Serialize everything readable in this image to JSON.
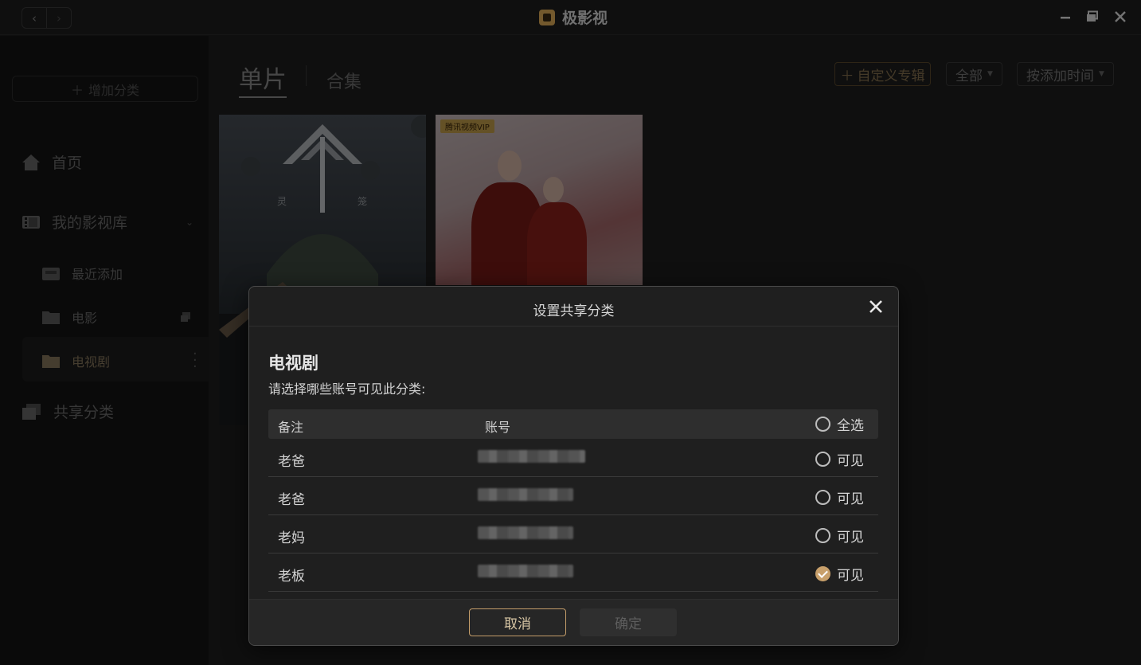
{
  "window": {
    "app_title": "极影视",
    "back_icon": "chevron-left-icon",
    "forward_icon": "chevron-right-icon"
  },
  "sidebar": {
    "add_category": "增加分类",
    "home": "首页",
    "library": "我的影视库",
    "items": [
      {
        "label": "最近添加",
        "icon": "recent-folder-icon"
      },
      {
        "label": "电影",
        "icon": "folder-icon"
      },
      {
        "label": "电视剧",
        "icon": "folder-icon"
      }
    ],
    "shared": "共享分类"
  },
  "main": {
    "tab_single": "单片",
    "tab_collection": "合集",
    "custom_album": "自定义专辑",
    "filter_all": "全部",
    "sort_by": "按添加时间",
    "posters": [
      {
        "title_left": "灵",
        "title_right": "笼"
      },
      {
        "badge": "腾讯视频VIP"
      }
    ]
  },
  "dialog": {
    "title": "设置共享分类",
    "category_name": "电视剧",
    "description": "请选择哪些账号可见此分类:",
    "col_note": "备注",
    "col_account": "账号",
    "select_all": "全选",
    "rows": [
      {
        "note": "老爸",
        "visible_label": "可见",
        "checked": false
      },
      {
        "note": "老爸",
        "visible_label": "可见",
        "checked": false
      },
      {
        "note": "老妈",
        "visible_label": "可见",
        "checked": false
      },
      {
        "note": "老板",
        "visible_label": "可见",
        "checked": true
      }
    ],
    "cancel": "取消",
    "confirm": "确定",
    "accent_color": "#c8a06b"
  }
}
